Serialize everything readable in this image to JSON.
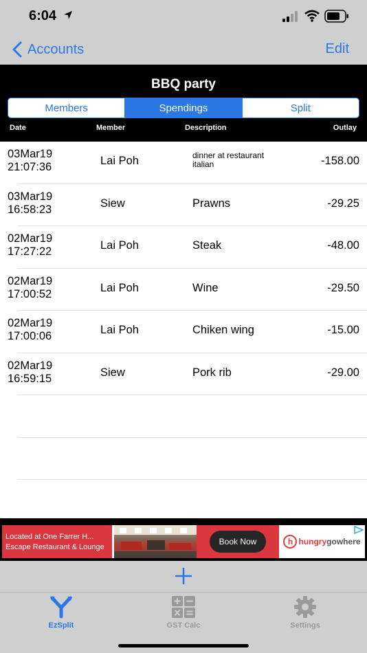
{
  "status_bar": {
    "time": "6:04"
  },
  "nav": {
    "back_label": "Accounts",
    "edit_label": "Edit"
  },
  "header": {
    "title": "BBQ party",
    "segments": [
      {
        "label": "Members",
        "active": false
      },
      {
        "label": "Spendings",
        "active": true
      },
      {
        "label": "Split",
        "active": false
      }
    ],
    "columns": {
      "date": "Date",
      "member": "Member",
      "description": "Description",
      "outlay": "Outlay"
    }
  },
  "spendings": [
    {
      "date": "03Mar19",
      "time": "21:07:36",
      "member": "Lai Poh",
      "description": "dinner at restaurant italian",
      "outlay": "-158.00"
    },
    {
      "date": "03Mar19",
      "time": "16:58:23",
      "member": "Siew",
      "description": "Prawns",
      "outlay": "-29.25"
    },
    {
      "date": "02Mar19",
      "time": "17:27:22",
      "member": "Lai Poh",
      "description": "Steak",
      "outlay": "-48.00"
    },
    {
      "date": "02Mar19",
      "time": "17:00:52",
      "member": "Lai Poh",
      "description": "Wine",
      "outlay": "-29.50"
    },
    {
      "date": "02Mar19",
      "time": "17:00:06",
      "member": "Lai Poh",
      "description": "Chiken wing",
      "outlay": "-15.00"
    },
    {
      "date": "02Mar19",
      "time": "16:59:15",
      "member": "Siew",
      "description": "Pork rib",
      "outlay": "-29.00"
    }
  ],
  "ad": {
    "line1": "Located at One Farrer H...",
    "line2": "Escape Restaurant & Lounge",
    "button": "Book Now",
    "brand_a": "hungry",
    "brand_b": "gowhere"
  },
  "tabs": [
    {
      "label": "EzSplit",
      "active": true
    },
    {
      "label": "GST Calc",
      "active": false
    },
    {
      "label": "Settings",
      "active": false
    }
  ],
  "colors": {
    "accent": "#2b78e4",
    "ad_red": "#d9363e",
    "bar_grey": "#cfcfcf"
  }
}
